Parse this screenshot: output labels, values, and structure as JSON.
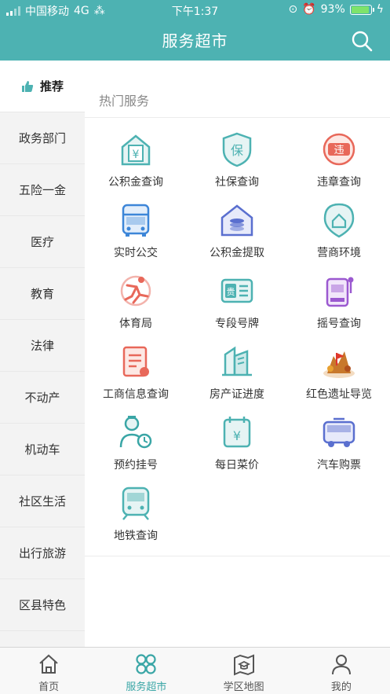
{
  "status": {
    "carrier": "中国移动",
    "network": "4G",
    "time": "下午1:37",
    "battery": "93%",
    "battery_level": 0.93
  },
  "header": {
    "title": "服务超市"
  },
  "sidebar": {
    "items": [
      {
        "label": "推荐",
        "active": true
      },
      {
        "label": "政务部门"
      },
      {
        "label": "五险一金"
      },
      {
        "label": "医疗"
      },
      {
        "label": "教育"
      },
      {
        "label": "法律"
      },
      {
        "label": "不动产"
      },
      {
        "label": "机动车"
      },
      {
        "label": "社区生活"
      },
      {
        "label": "出行旅游"
      },
      {
        "label": "区县特色"
      }
    ]
  },
  "section": {
    "title": "热门服务"
  },
  "services": [
    {
      "label": "公积金查询",
      "icon": "housing-fund-icon",
      "glyph": "¥",
      "color": "#4db2b2"
    },
    {
      "label": "社保查询",
      "icon": "social-security-icon",
      "glyph": "保",
      "color": "#4db2b2"
    },
    {
      "label": "违章查询",
      "icon": "violation-icon",
      "glyph": "违",
      "color": "#e8685a"
    },
    {
      "label": "实时公交",
      "icon": "bus-icon",
      "glyph": "",
      "color": "#3d86d8"
    },
    {
      "label": "公积金提取",
      "icon": "fund-withdraw-icon",
      "glyph": "",
      "color": "#5a6fcf"
    },
    {
      "label": "营商环境",
      "icon": "business-env-icon",
      "glyph": "",
      "color": "#4db2b2"
    },
    {
      "label": "体育局",
      "icon": "sports-icon",
      "glyph": "",
      "color": "#e8685a"
    },
    {
      "label": "专段号牌",
      "icon": "license-plate-icon",
      "glyph": "贵",
      "color": "#4db2b2"
    },
    {
      "label": "摇号查询",
      "icon": "lottery-icon",
      "glyph": "",
      "color": "#9b59d0"
    },
    {
      "label": "工商信息查询",
      "icon": "business-info-icon",
      "glyph": "",
      "color": "#e8685a"
    },
    {
      "label": "房产证进度",
      "icon": "property-cert-icon",
      "glyph": "",
      "color": "#4db2b2"
    },
    {
      "label": "红色遗址导览",
      "icon": "red-heritage-icon",
      "glyph": "",
      "color": "#c8782c"
    },
    {
      "label": "预约挂号",
      "icon": "appointment-icon",
      "glyph": "",
      "color": "#3aa6a6"
    },
    {
      "label": "每日菜价",
      "icon": "veg-price-icon",
      "glyph": "¥",
      "color": "#4db2b2"
    },
    {
      "label": "汽车购票",
      "icon": "coach-ticket-icon",
      "glyph": "",
      "color": "#5a6fcf"
    },
    {
      "label": "地铁查询",
      "icon": "metro-icon",
      "glyph": "",
      "color": "#4db2b2"
    }
  ],
  "tabbar": {
    "items": [
      {
        "label": "首页",
        "icon": "home-icon"
      },
      {
        "label": "服务超市",
        "icon": "service-market-icon",
        "active": true
      },
      {
        "label": "学区地图",
        "icon": "school-map-icon"
      },
      {
        "label": "我的",
        "icon": "profile-icon"
      }
    ]
  }
}
